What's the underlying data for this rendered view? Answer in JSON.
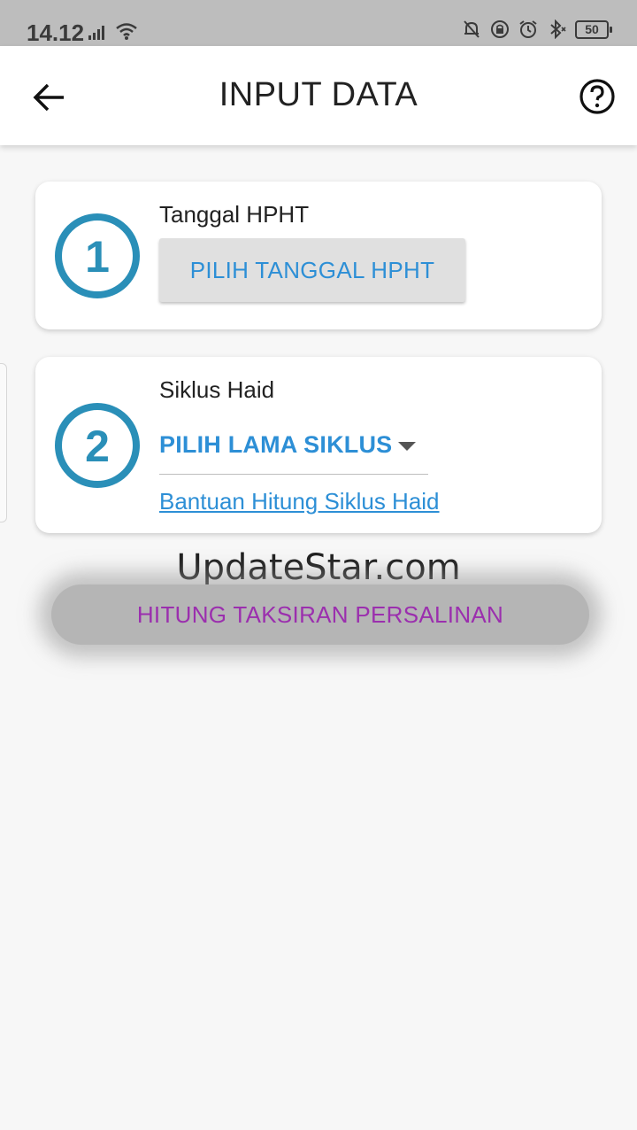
{
  "status_bar": {
    "time": "14.12",
    "battery": "50",
    "icons": [
      "signal-icon",
      "wifi-icon",
      "mute-bell-icon",
      "lock-rotation-icon",
      "alarm-icon",
      "bluetooth-icon",
      "battery-icon"
    ]
  },
  "app_bar": {
    "title": "INPUT DATA",
    "back_icon": "arrow-left-icon",
    "help_icon": "help-circle-icon"
  },
  "step1": {
    "number": "1",
    "label": "Tanggal HPHT",
    "button_label": "PILIH TANGGAL HPHT"
  },
  "step2": {
    "number": "2",
    "label": "Siklus Haid",
    "dropdown_value": "PILIH LAMA SIKLUS",
    "help_link": "Bantuan Hitung Siklus Haid"
  },
  "watermark": "UpdateStar.com",
  "calculate_button": "HITUNG TAKSIRAN PERSALINAN",
  "colors": {
    "accent_blue": "#2d8fd6",
    "step_circle": "#2a8fb8",
    "calc_text": "#9b2fae"
  }
}
